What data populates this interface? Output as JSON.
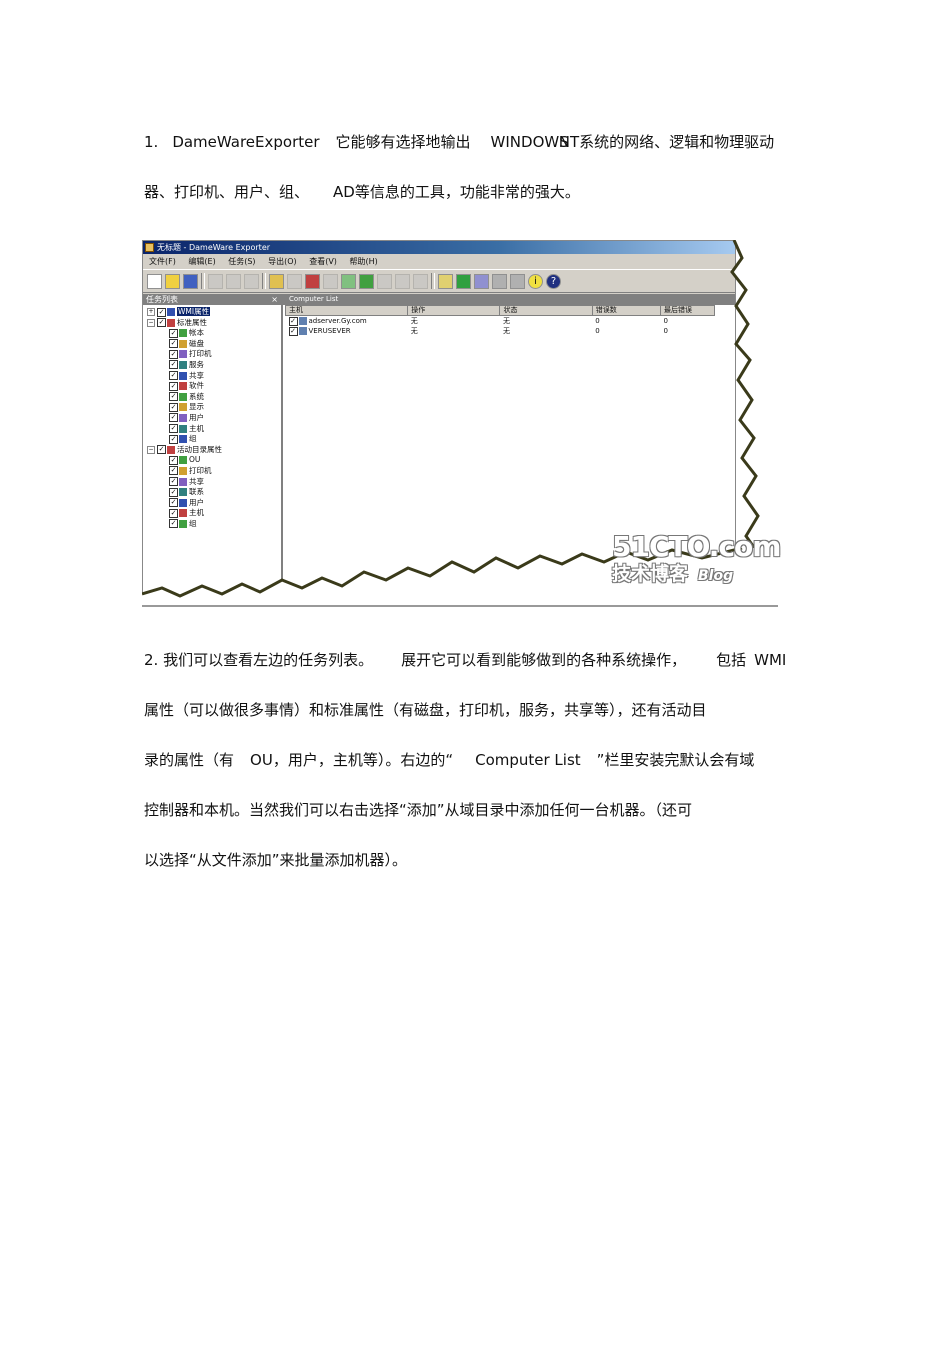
{
  "para1": {
    "line1": [
      "1.",
      "DameWareExporter",
      "它能够有选择地输出",
      "WINDOWS",
      "NT",
      "系统的网络、逻辑和物理驱动"
    ],
    "line2": [
      "器、打印机、用户、组、",
      "AD等信息的工具，功能非常的强大。"
    ]
  },
  "figure": {
    "window_title": "无标题 - DameWare Exporter",
    "menu": [
      "文件(F)",
      "编辑(E)",
      "任务(S)",
      "导出(O)",
      "查看(V)",
      "帮助(H)"
    ],
    "left_pane_title": "任务列表",
    "left_pane_close": "×",
    "right_pane_title": "Computer List",
    "tree": [
      {
        "label": "WMI属性",
        "level": 0,
        "selected": true
      },
      {
        "label": "标准属性",
        "level": 0
      },
      {
        "label": "帐本",
        "level": 1
      },
      {
        "label": "磁盘",
        "level": 1
      },
      {
        "label": "打印机",
        "level": 1
      },
      {
        "label": "服务",
        "level": 1
      },
      {
        "label": "共享",
        "level": 1
      },
      {
        "label": "软件",
        "level": 1
      },
      {
        "label": "系统",
        "level": 1
      },
      {
        "label": "显示",
        "level": 1
      },
      {
        "label": "用户",
        "level": 1
      },
      {
        "label": "主机",
        "level": 1
      },
      {
        "label": "组",
        "level": 1
      },
      {
        "label": "活动目录属性",
        "level": 0
      },
      {
        "label": "OU",
        "level": 1
      },
      {
        "label": "打印机",
        "level": 1
      },
      {
        "label": "共享",
        "level": 1
      },
      {
        "label": "联系",
        "level": 1
      },
      {
        "label": "用户",
        "level": 1
      },
      {
        "label": "主机",
        "level": 1
      },
      {
        "label": "组",
        "level": 1
      }
    ],
    "columns": [
      "主机",
      "操作",
      "状态",
      "错误数",
      "最后错误"
    ],
    "rows": [
      [
        "adserver.Gy.com",
        "无",
        "无",
        "0",
        "0"
      ],
      [
        "VERUSEVER",
        "无",
        "无",
        "0",
        "0"
      ]
    ],
    "watermark": {
      "site": "51CTO.com",
      "cn": "技术博客",
      "blog": "Blog"
    }
  },
  "para2": {
    "line1": [
      "2. 我们可以查看左边的任务列表。",
      "展开它可以看到能够做到的各种系统操作，",
      "包括",
      "WMI"
    ],
    "line2": "属性（可以做很多事情）和标准属性（有磁盘，打印机，服务，共享等），还有活动目",
    "line3": [
      "录的属性（有",
      "OU",
      "，用户，主机等）。右边的“",
      "Computer List",
      "”栏里安装完默认会有域"
    ],
    "line4": "控制器和本机。当然我们可以右击选择“添加”从域目录中添加任何一台机器。（还可",
    "line5": "以选择“从文件添加”来批量添加机器）。"
  }
}
